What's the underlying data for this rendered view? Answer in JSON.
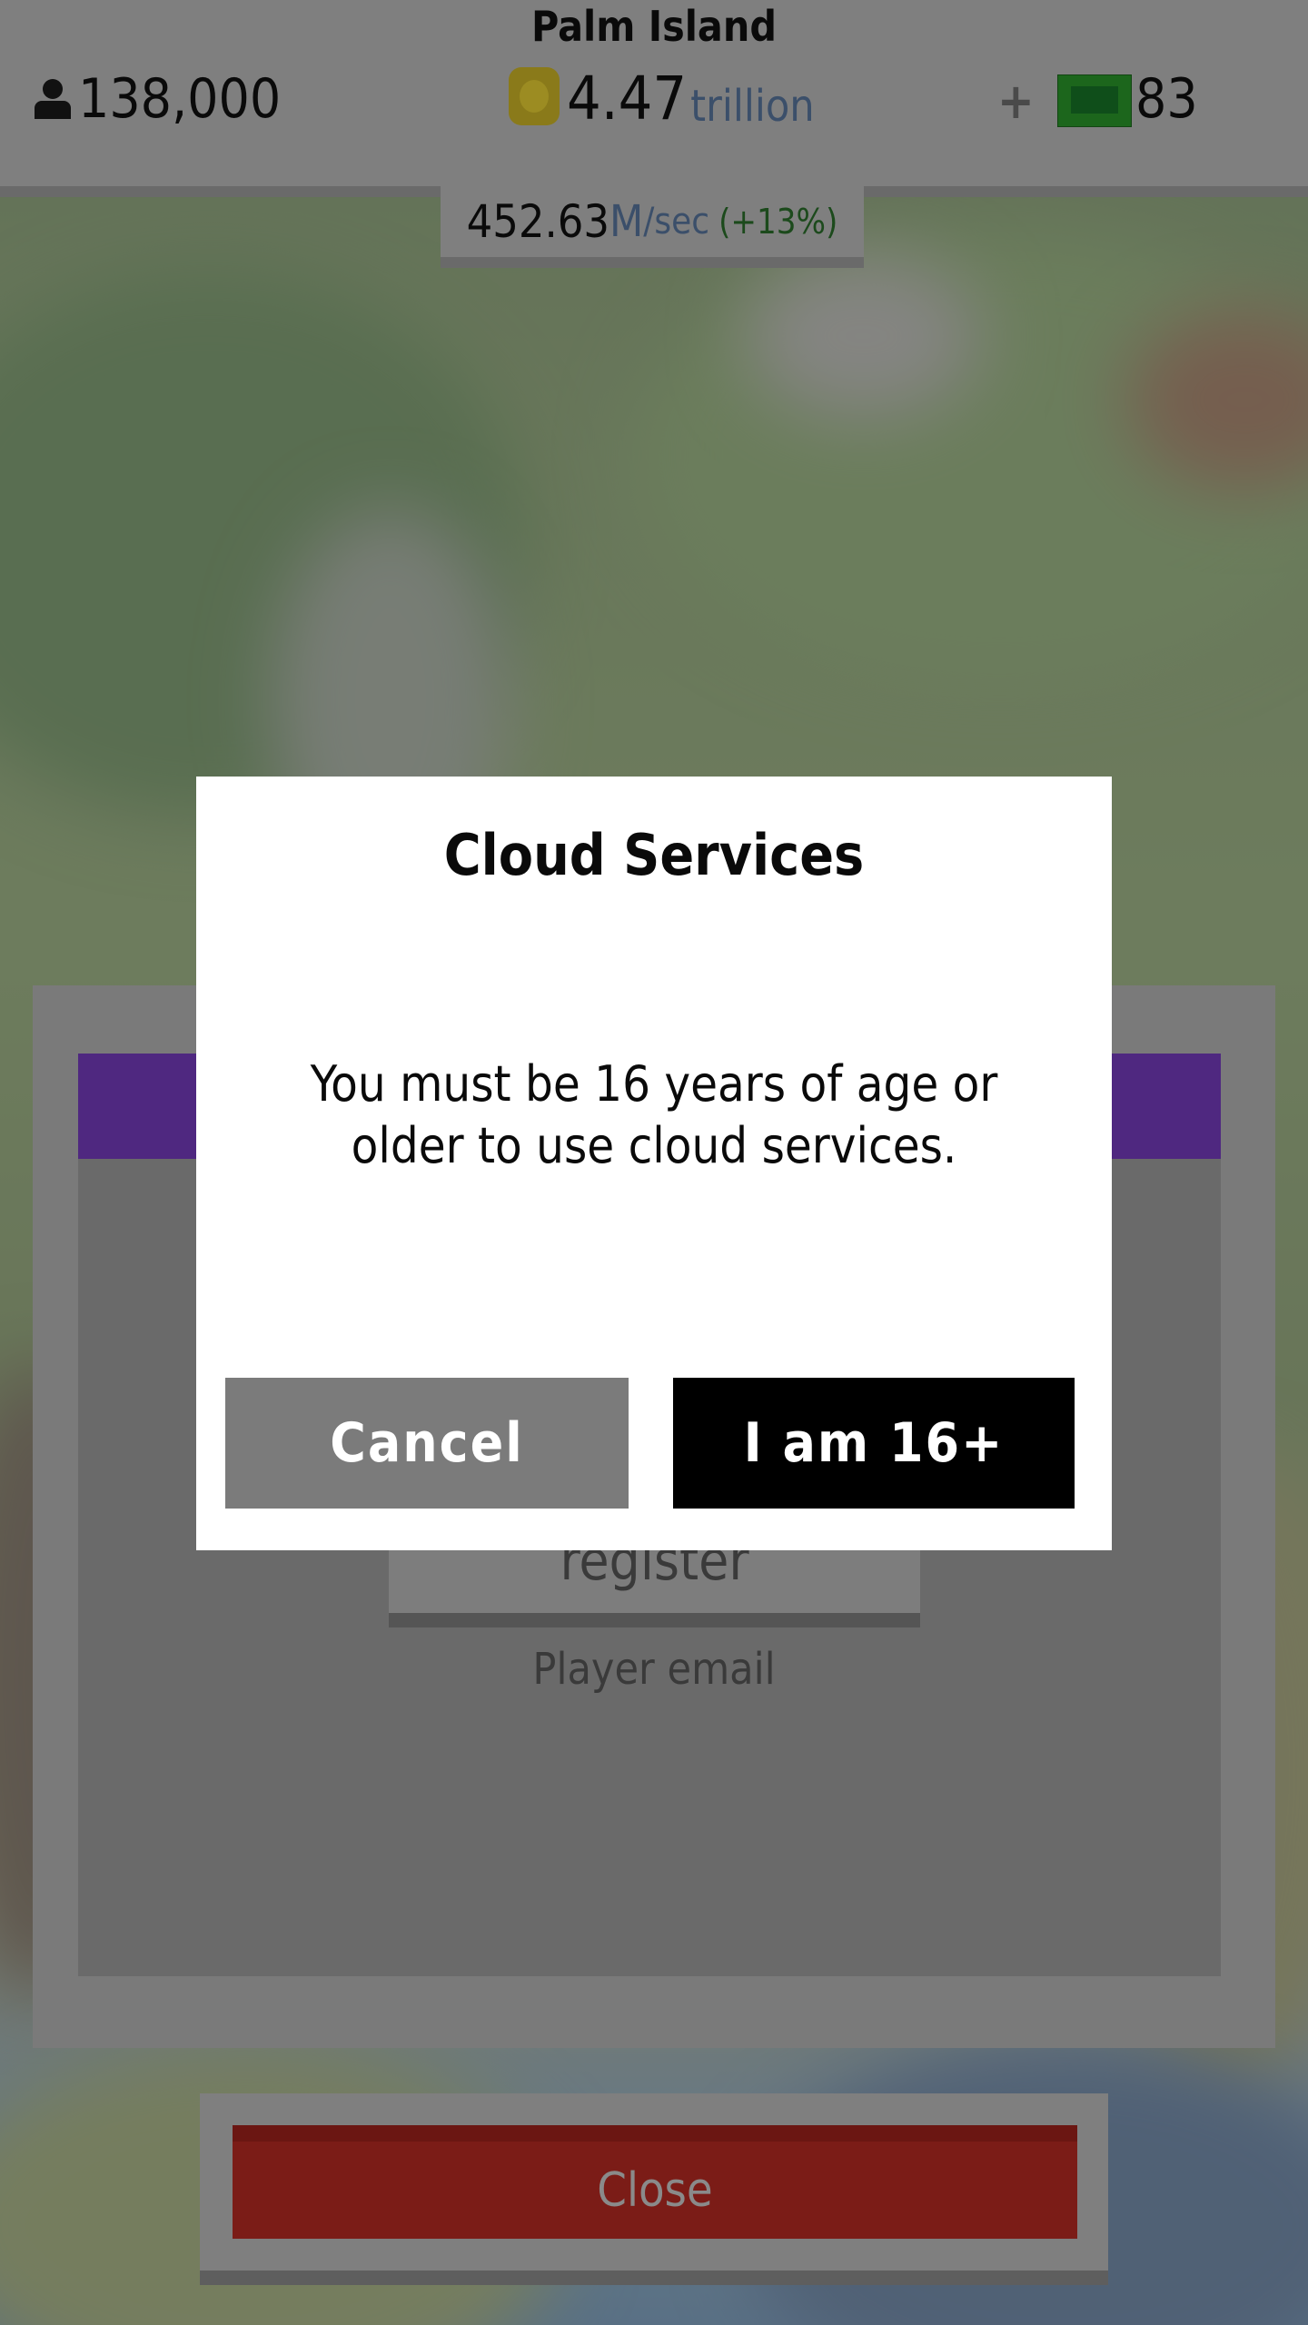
{
  "hud": {
    "island_name": "Palm Island",
    "population": "138,000",
    "money_value": "4.47",
    "money_unit": "trillion",
    "plus_label": "+",
    "cash_count": "83",
    "rate_value": "452.63",
    "rate_unit": "M",
    "rate_suffix": "/sec",
    "rate_change": "(+13%)",
    "icons": [
      "person-icon",
      "coin-icon",
      "cash-icon"
    ]
  },
  "background_panel": {
    "register_label": "register",
    "email_label": "Player email",
    "close_label": "Close"
  },
  "dialog": {
    "title": "Cloud Services",
    "message": "You must be 16 years of age or older to use cloud services.",
    "cancel_label": "Cancel",
    "confirm_label": "I am 16+"
  },
  "colors": {
    "panel_accent": "#4f2880",
    "close_button": "#7b1c17",
    "cash": "#1c661c",
    "coin": "#8a7a1a",
    "confirm_button": "#000000",
    "cancel_button": "#7b7b7b"
  }
}
